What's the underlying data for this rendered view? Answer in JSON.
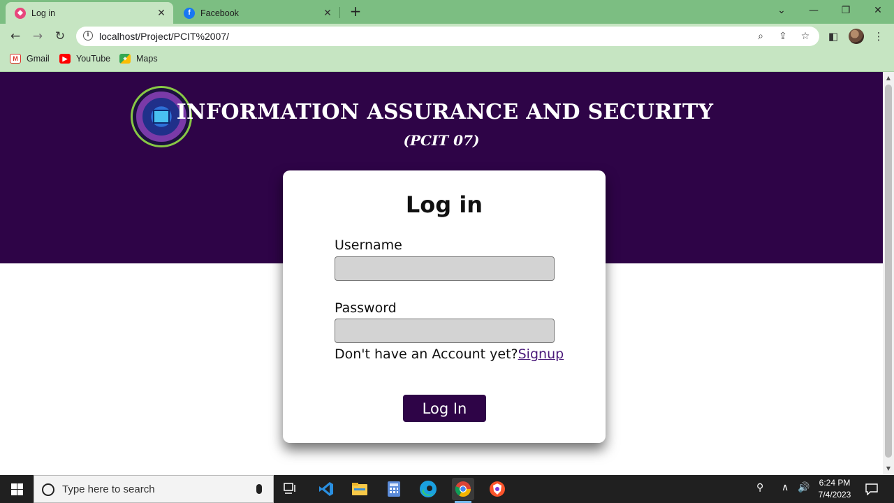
{
  "browser": {
    "tabs": [
      {
        "title": "Log in",
        "active": true,
        "favicon": "vitejs-favicon",
        "favicon_color": "#e8467c"
      },
      {
        "title": "Facebook",
        "active": false,
        "favicon": "facebook-icon",
        "favicon_color": "#1877f2"
      }
    ],
    "new_tab": "+",
    "url": "localhost/Project/PCIT%2007/",
    "bookmarks": [
      {
        "label": "Gmail",
        "icon": "gmail-icon"
      },
      {
        "label": "YouTube",
        "icon": "youtube-icon"
      },
      {
        "label": "Maps",
        "icon": "maps-icon"
      }
    ],
    "theme": {
      "tabbar": "#7cbe82",
      "toolbar": "#c6e5c2"
    }
  },
  "page": {
    "header_title": "INFORMATION ASSURANCE AND SECURITY",
    "header_subtitle": "(PCIT 07)",
    "brand_color": "#2e0447",
    "login": {
      "heading": "Log in",
      "username_label": "Username",
      "username_value": "",
      "password_label": "Password",
      "password_value": "",
      "signup_prompt": "Don't have an Account yet?",
      "signup_link": "Signup",
      "submit": "Log In"
    }
  },
  "taskbar": {
    "search_placeholder": "Type here to search",
    "apps": [
      "task-view-icon",
      "vscode-icon",
      "file-explorer-icon",
      "calculator-icon",
      "edge-icon",
      "chrome-icon",
      "brave-icon"
    ],
    "time": "6:24 PM",
    "date": "7/4/2023"
  }
}
